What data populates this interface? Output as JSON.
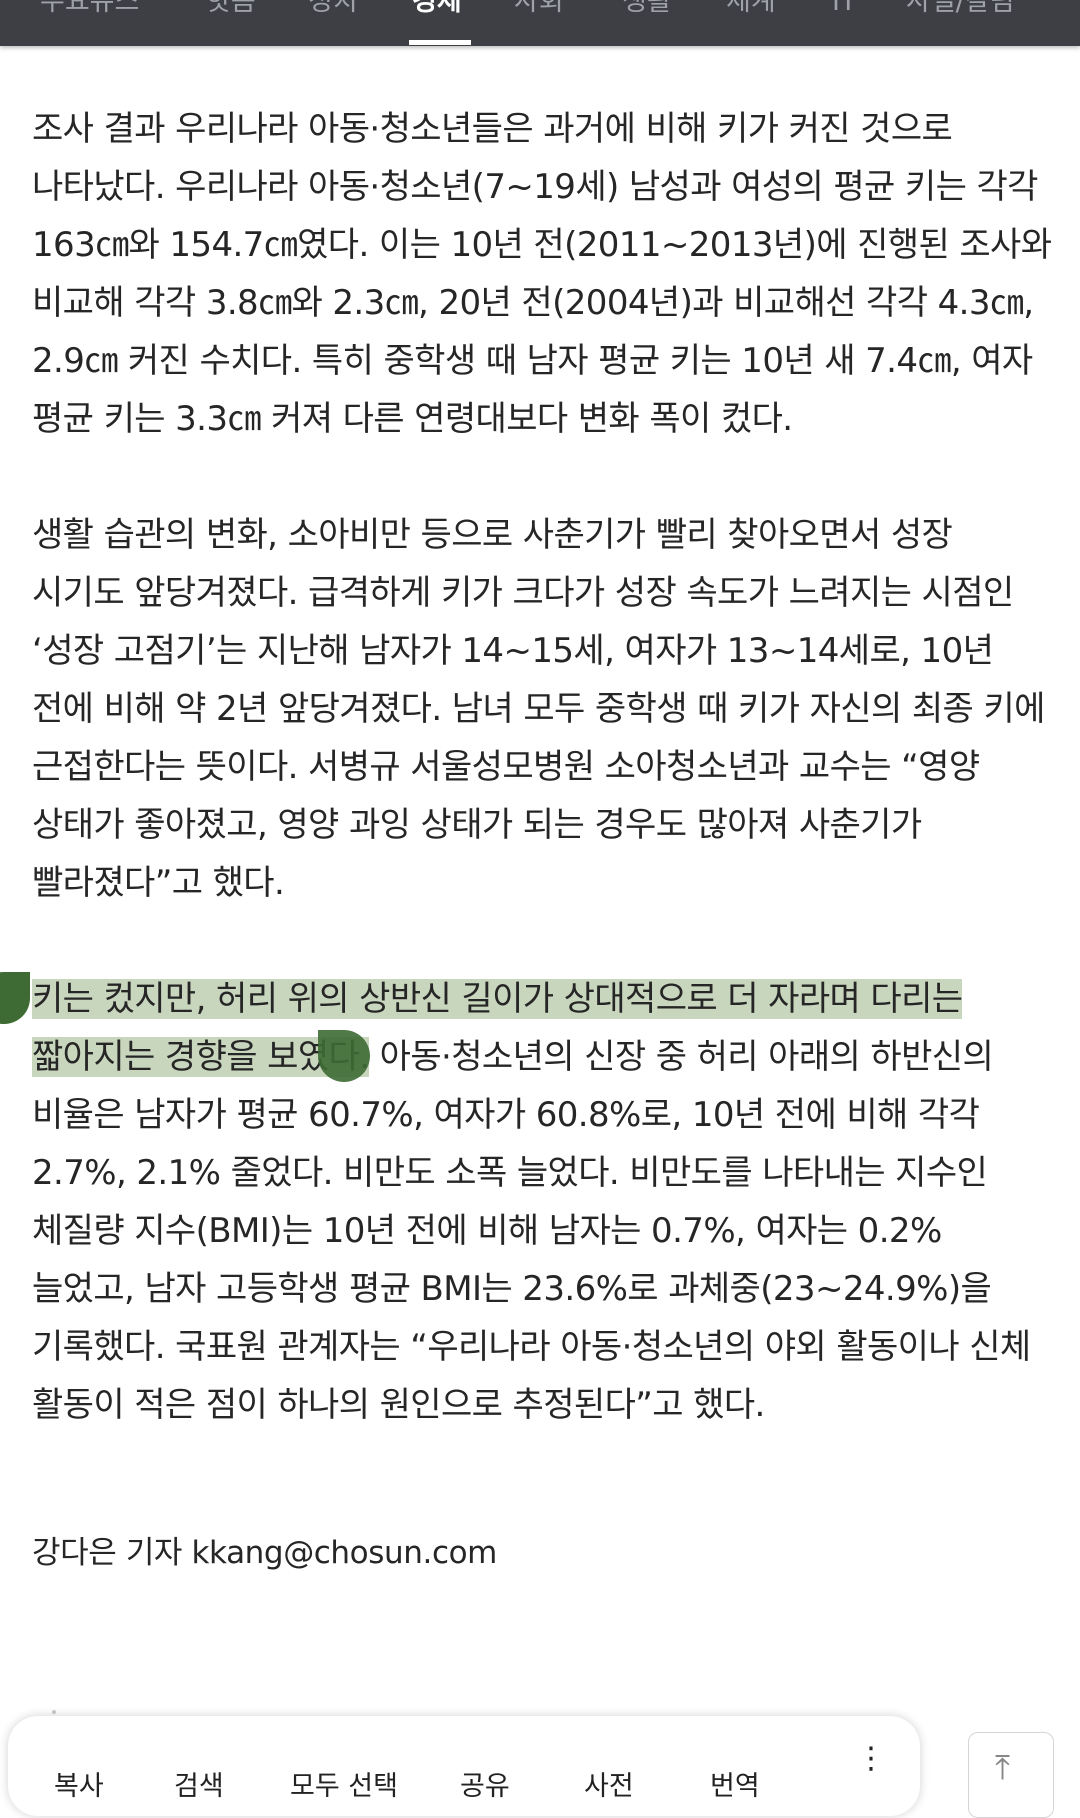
{
  "topnav": {
    "tabs": [
      {
        "label": "주요뉴스",
        "active": false
      },
      {
        "label": "핫픔",
        "active": false
      },
      {
        "label": "정치",
        "active": false
      },
      {
        "label": "경제",
        "active": true
      },
      {
        "label": "사회",
        "active": false
      },
      {
        "label": "생활",
        "active": false
      },
      {
        "label": "세계",
        "active": false
      },
      {
        "label": "IT",
        "active": false
      },
      {
        "label": "사설/칼럼",
        "active": false
      }
    ]
  },
  "article": {
    "p1": "조사 결과 우리나라 아동·청소년들은 과거에 비해 키가 커진 것으로 나타났다. 우리나라 아동·청소년(7~19세) 남성과 여성의 평균 키는 각각 163㎝와 154.7㎝였다. 이는 10년 전(2011~2013년)에 진행된 조사와 비교해 각각 3.8㎝와 2.3㎝, 20년 전(2004년)과 비교해선 각각 4.3㎝, 2.9㎝ 커진 수치다. 특히 중학생 때 남자 평균 키는 10년 새 7.4㎝, 여자 평균 키는 3.3㎝ 커져 다른 연령대보다 변화 폭이 컸다.",
    "p2": "생활 습관의 변화, 소아비만 등으로 사춘기가 빨리 찾아오면서 성장 시기도 앞당겨졌다. 급격하게 키가 크다가 성장 속도가 느려지는 시점인 ‘성장 고점기’는 지난해 남자가 14~15세, 여자가 13~14세로, 10년 전에 비해 약 2년 앞당겨졌다. 남녀 모두 중학생 때 키가 자신의 최종 키에 근접한다는 뜻이다. 서병규 서울성모병원 소아청소년과 교수는 “영양 상태가 좋아졌고, 영양 과잉 상태가 되는 경우도 많아져 사춘기가 빨라졌다”고 했다.",
    "p3_highlight": "키는 컸지만, 허리 위의 상반신 길이가 상대적으로 더 자라며 다리는 짧아지는 경향을 보였다.",
    "p3_rest": " 아동·청소년의 신장 중 허리 아래의 하반신의 비율은 남자가 평균 60.7%, 여자가 60.8%로, 10년 전에 비해 각각 2.7%, 2.1% 줄었다. 비만도 소폭 늘었다. 비만도를 나타내는 지수인 체질량 지수(BMI)는 10년 전에 비해 남자는 0.7%, 여자는 0.2% 늘었고, 남자 고등학생 평균 BMI는 23.6%로 과체중(23~24.9%)을 기록했다. 국표원 관계자는 “우리나라 아동·청소년의 야외 활동이나 신체 활동이 적은 점이 하나의 원인으로 추정된다”고 했다.",
    "byline": "강다은 기자 kkang@chosun.com"
  },
  "selection_toolbar": {
    "actions": [
      "복사",
      "검색",
      "모두 선택",
      "공유",
      "사전",
      "번역"
    ],
    "more_icon": "more-vertical-icon"
  },
  "scroll_top": {
    "icon": "arrow-up-icon"
  },
  "colors": {
    "nav_bg": "#3d3f44",
    "highlight": "#c9d6be",
    "handle": "#3d6b33"
  }
}
